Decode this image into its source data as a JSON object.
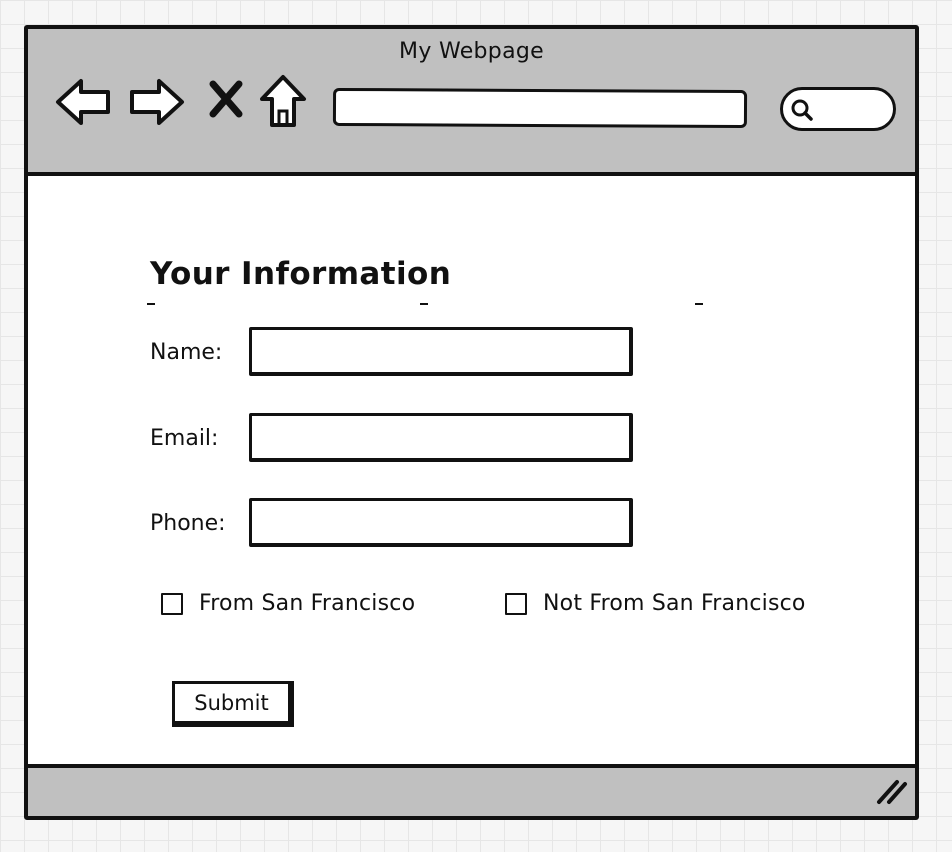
{
  "window": {
    "title": "My Webpage"
  },
  "toolbar": {
    "icons": [
      "back-arrow-icon",
      "forward-arrow-icon",
      "stop-x-icon",
      "home-icon",
      "search-icon"
    ],
    "url_value": "",
    "search_value": ""
  },
  "form": {
    "title": "Your Information",
    "fields": [
      {
        "label": "Name:",
        "value": ""
      },
      {
        "label": "Email:",
        "value": ""
      },
      {
        "label": "Phone:",
        "value": ""
      }
    ],
    "checkboxes": [
      {
        "label": "From San Francisco",
        "checked": false
      },
      {
        "label": "Not From San Francisco",
        "checked": false
      }
    ],
    "submit_label": "Submit"
  },
  "colors": {
    "chrome": "#c0c0c0",
    "stroke": "#111111",
    "background": "#ffffff"
  }
}
